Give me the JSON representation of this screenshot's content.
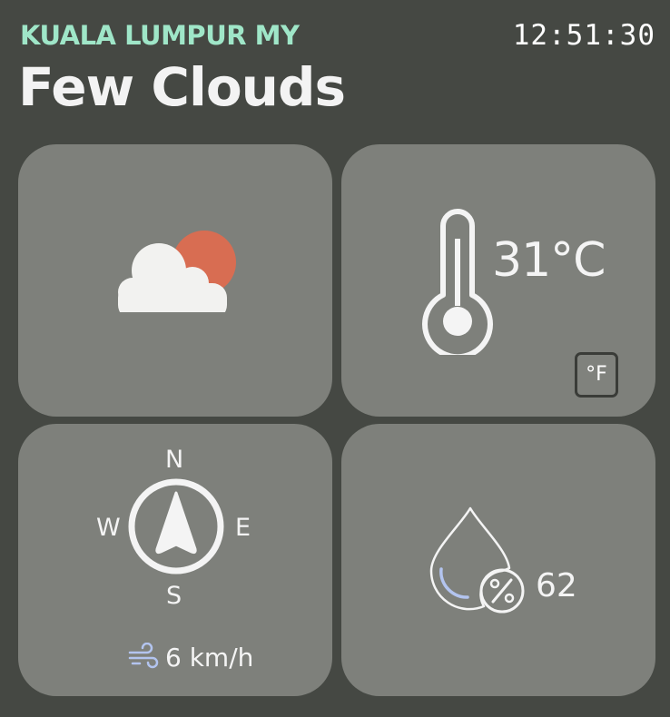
{
  "header": {
    "city": "KUALA LUMPUR MY",
    "time": "12:51:30",
    "condition": "Few Clouds"
  },
  "weather": {
    "icon": "few-clouds-icon",
    "colors": {
      "sun": "#d86d52",
      "cloud": "#f2f2f0"
    }
  },
  "temperature": {
    "value": "31°C",
    "unit_toggle_label": "°F",
    "icon": "thermometer-icon"
  },
  "wind": {
    "compass_labels": {
      "n": "N",
      "s": "S",
      "w": "W",
      "e": "E"
    },
    "speed": "6 km/h",
    "direction_icon": "navigation-arrow-icon",
    "icon": "wind-icon",
    "colors": {
      "wind_icon": "#b3c4ef"
    }
  },
  "humidity": {
    "value": "62",
    "icon": "humidity-drop-icon",
    "colors": {
      "arc": "#b3c4ef"
    }
  },
  "theme": {
    "background": "#454843",
    "tile": "#7e807b",
    "accent": "#9fe6c8",
    "text": "#f4f4f4"
  }
}
